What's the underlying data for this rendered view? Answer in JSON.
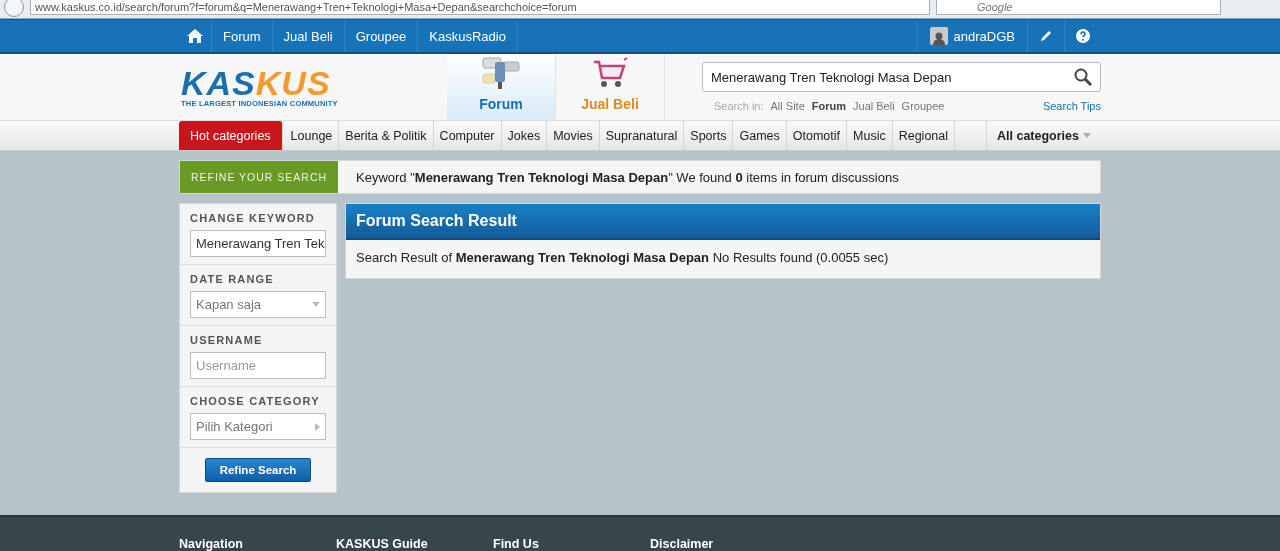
{
  "browser": {
    "url": "www.kaskus.co.id/search/forum?f=forum&q=Menerawang+Tren+Teknologi+Masa+Depan&searchchoice=forum",
    "search_placeholder": "Google"
  },
  "top_nav": {
    "items": [
      "Forum",
      "Jual Beli",
      "Groupee",
      "KaskusRadio"
    ],
    "username": "andraDGB"
  },
  "logo": {
    "first": "KAS",
    "second": "KUS",
    "tagline": "THE LARGEST INDONESIAN COMMUNITY"
  },
  "sections": [
    {
      "label": "Forum",
      "selected": true
    },
    {
      "label": "Jual Beli",
      "selected": false
    }
  ],
  "search": {
    "value": "Menerawang Tren Teknologi Masa Depan",
    "scope_label": "Search in:",
    "scopes": [
      {
        "label": "All Site",
        "selected": false
      },
      {
        "label": "Forum",
        "selected": true
      },
      {
        "label": "Jual Beli",
        "selected": false
      },
      {
        "label": "Groupee",
        "selected": false
      }
    ],
    "tips": "Search Tips"
  },
  "categories": [
    {
      "label": "Hot categories",
      "kind": "hot"
    },
    {
      "label": "Lounge",
      "kind": "item"
    },
    {
      "label": "Berita & Politik",
      "kind": "item"
    },
    {
      "label": "Computer",
      "kind": "item"
    },
    {
      "label": "Jokes",
      "kind": "item"
    },
    {
      "label": "Movies",
      "kind": "item"
    },
    {
      "label": "Supranatural",
      "kind": "item"
    },
    {
      "label": "Sports",
      "kind": "item"
    },
    {
      "label": "Games",
      "kind": "item"
    },
    {
      "label": "Otomotif",
      "kind": "item"
    },
    {
      "label": "Music",
      "kind": "item"
    },
    {
      "label": "Regional",
      "kind": "item"
    },
    {
      "label": "All categories",
      "kind": "all"
    }
  ],
  "refine_tab": "REFINE YOUR SEARCH",
  "summary": "Keyword \"**Menerawang Tren Teknologi Masa Depan**\" We found **0** items in forum discussions",
  "filters": [
    {
      "label": "CHANGE KEYWORD",
      "kind": "text",
      "value": "Menerawang Tren Tek"
    },
    {
      "label": "DATE RANGE",
      "kind": "select",
      "value": "Kapan saja"
    },
    {
      "label": "USERNAME",
      "kind": "text",
      "placeholder": "Username"
    },
    {
      "label": "CHOOSE CATEGORY",
      "kind": "menu",
      "value": "Pilih Kategori"
    }
  ],
  "refine_button": "Refine Search",
  "result": {
    "title": "Forum Search Result",
    "text": "Search Result of **Menerawang Tren Teknologi Masa Depan** No Results found (0.0055 sec)"
  },
  "footer": [
    "Navigation",
    "KASKUS Guide",
    "Find Us",
    "Disclaimer"
  ]
}
